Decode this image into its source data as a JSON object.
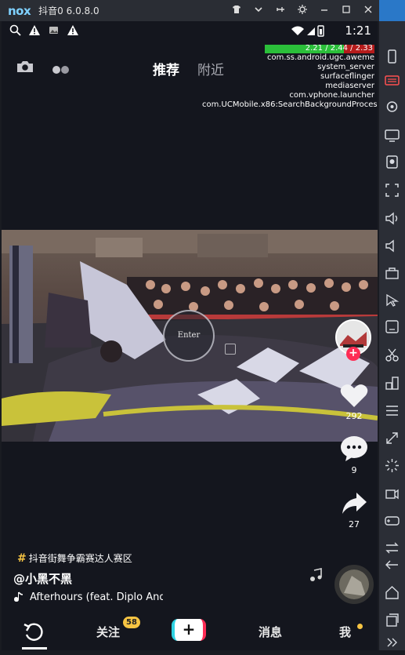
{
  "window": {
    "logo": "nox",
    "title": "抖音0 6.0.8.0",
    "controls": [
      "shirt-icon",
      "chevron-down-icon",
      "pin-icon",
      "gear-icon",
      "minimize-icon",
      "maximize-icon",
      "close-icon"
    ]
  },
  "status_bar": {
    "time": "1:21",
    "left_icons": [
      "search-icon",
      "warning-icon",
      "image-icon",
      "warning-icon"
    ]
  },
  "top_nav": {
    "tabs": [
      {
        "label": "推荐",
        "active": true
      },
      {
        "label": "附近",
        "active": false
      }
    ]
  },
  "debug_overlay": {
    "load": "2.21 / 2.44 / 2.33",
    "processes": [
      "com.ss.android.ugc.aweme",
      "system_server",
      "surfaceflinger",
      "mediaserver",
      "com.vphone.launcher",
      "com.UCMobile.x86:SearchBackgroundProcess"
    ]
  },
  "video": {
    "enter_label": "Enter"
  },
  "actions": {
    "likes": "292",
    "comments": "9",
    "shares": "27"
  },
  "post": {
    "hashtag": "抖音街舞争霸赛达人赛区",
    "author": "@小黑不黑",
    "song": "Afterhours (feat. Diplo And"
  },
  "bottom_nav": {
    "items": [
      {
        "label": "",
        "icon": "refresh-icon"
      },
      {
        "label": "关注",
        "badge": "58"
      },
      {
        "label": "+"
      },
      {
        "label": "消息"
      },
      {
        "label": "我"
      }
    ]
  },
  "colors": {
    "accent_red": "#fe2c55",
    "accent_cyan": "#2fd3e3",
    "badge_yellow": "#f6c443",
    "background": "#14161e"
  }
}
